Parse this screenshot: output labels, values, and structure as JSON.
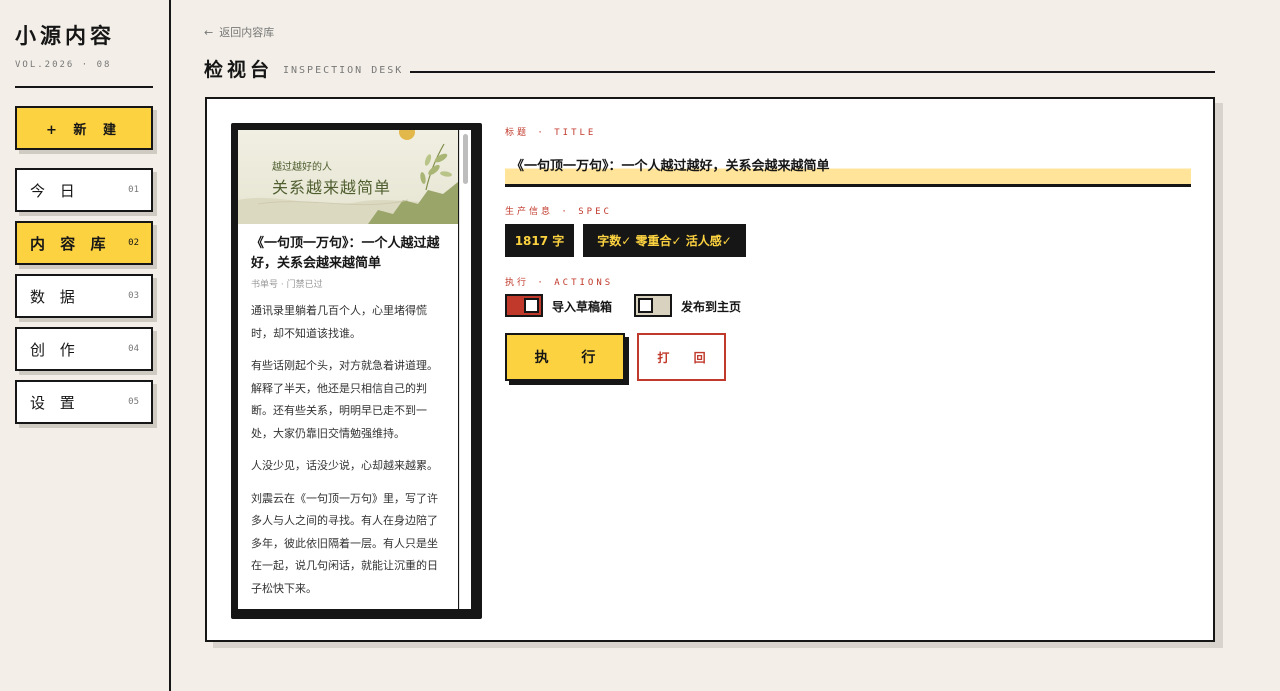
{
  "sidebar": {
    "brand": "小源内容",
    "vol": "VOL.2026 · 08",
    "new_button": "+ 新 建",
    "items": [
      {
        "label": "今 日",
        "num": "01"
      },
      {
        "label": "内 容 库",
        "num": "02"
      },
      {
        "label": "数 据",
        "num": "03"
      },
      {
        "label": "创 作",
        "num": "04"
      },
      {
        "label": "设 置",
        "num": "05"
      }
    ],
    "active_index": 1
  },
  "header": {
    "back_arrow": "←",
    "back_label": "返回内容库",
    "title": "检视台",
    "subtitle": "INSPECTION DESK"
  },
  "preview": {
    "banner_sub": "越过越好的人",
    "banner_main": "关系越来越简单",
    "article_title": "《一句顶一万句》：一个人越过越好，关系会越来越简单",
    "meta": "书单号 · 门禁已过",
    "paragraphs": [
      "通讯录里躺着几百个人，心里堵得慌时，却不知道该找谁。",
      "有些话刚起个头，对方就急着讲道理。解释了半天，他还是只相信自己的判断。还有些关系，明明早已走不到一处，大家仍靠旧交情勉强维持。",
      "人没少见，话没少说，心却越来越累。",
      "刘震云在《一句顶一万句》里，写了许多人与人之间的寻找。有人在身边陪了多年，彼此依旧隔着一层。有人只是坐在一起，说几句闲话，就能让沉重的日子松快下来。"
    ]
  },
  "form": {
    "title_label": "标题 · TITLE",
    "title_value": "《一句顶一万句》：一个人越过越好，关系会越来越简单",
    "spec_label": "生产信息 · SPEC",
    "spec_badges": [
      "1817 字",
      "字数✓ 零重合✓ 活人感✓"
    ],
    "actions_label": "执行 · ACTIONS",
    "toggles": [
      {
        "label": "导入草稿箱",
        "on": true
      },
      {
        "label": "发布到主页",
        "on": false
      }
    ],
    "execute_button": "执 行",
    "reject_button": "打 回"
  },
  "colors": {
    "accent_yellow": "#fcd240",
    "accent_red": "#c0392b",
    "ink": "#161616",
    "paper": "#f3efe8",
    "highlight": "#ffe49a"
  }
}
